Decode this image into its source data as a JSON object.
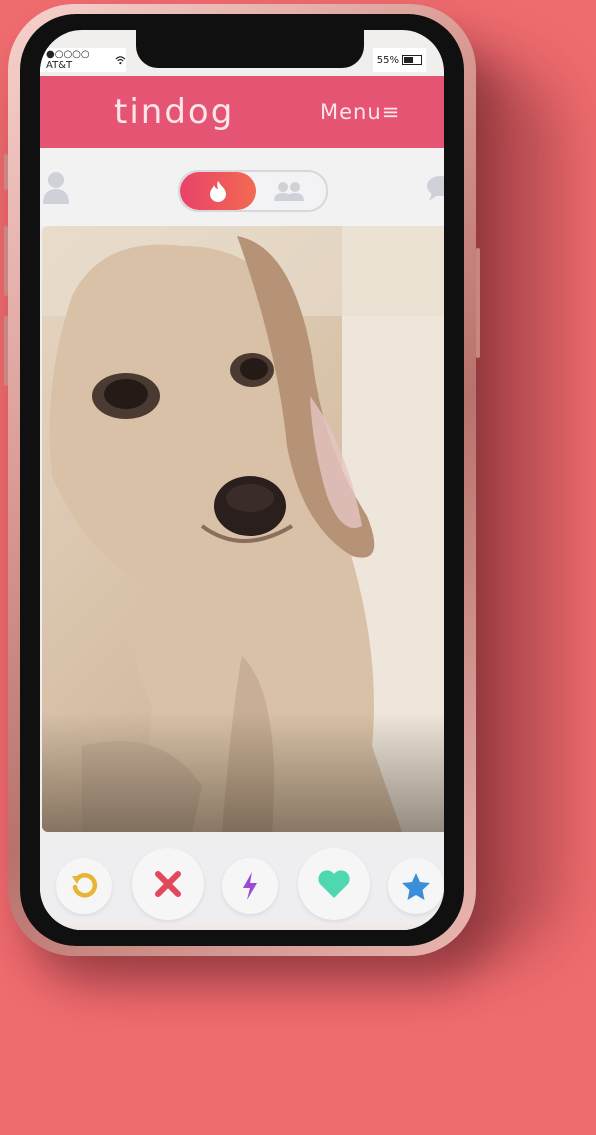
{
  "status_bar": {
    "carrier": "●○○○○ AT&T",
    "battery": "55%"
  },
  "header": {
    "brand": "tindog",
    "menu_label": "Menu",
    "menu_icon": "≡"
  },
  "colors": {
    "header": "#e55472",
    "background": "#ee6b6e",
    "accent_gradient": [
      "#e94269",
      "#f26a51"
    ]
  },
  "toolbar": {
    "left_icon": "profile-icon",
    "toggle_active_icon": "flame-icon",
    "toggle_inactive_icon": "group-icon",
    "right_icon": "chat-icon"
  },
  "actions": [
    {
      "name": "rewind",
      "icon": "undo-icon",
      "color": "#e8b533"
    },
    {
      "name": "nope",
      "icon": "close-icon",
      "color": "#e2475c"
    },
    {
      "name": "boost",
      "icon": "lightning-icon",
      "color": "#9b4ad8"
    },
    {
      "name": "like",
      "icon": "heart-icon",
      "color": "#4fd7b0"
    },
    {
      "name": "super-like",
      "icon": "star-icon",
      "color": "#3a8fd9"
    }
  ]
}
